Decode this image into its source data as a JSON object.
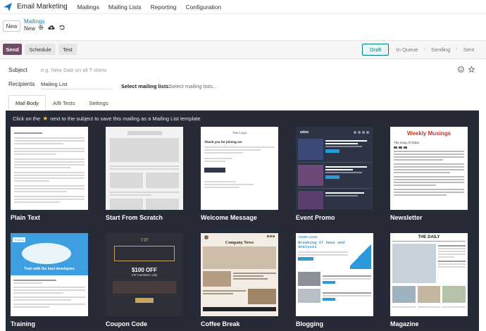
{
  "nav": {
    "app_title": "Email Marketing",
    "menu": [
      "Mailings",
      "Mailing Lists",
      "Reporting",
      "Configuration"
    ]
  },
  "control_panel": {
    "new_button": "New",
    "breadcrumb_parent": "Mailings",
    "breadcrumb_current": "New"
  },
  "actions": {
    "send": "Send",
    "schedule": "Schedule",
    "test": "Test",
    "stages": [
      "Draft",
      "In Queue",
      "Sending",
      "Sent"
    ],
    "active_stage": "Draft"
  },
  "form": {
    "subject_label": "Subject",
    "subject_placeholder": "e.g. New Sale on all T-shirts",
    "recipients_label": "Recipients",
    "recipients_value": "Mailing List",
    "mailing_lists_label": "Select mailing lists:",
    "mailing_lists_placeholder": "Select mailing lists..."
  },
  "tabs": [
    "Mail Body",
    "A/B Tests",
    "Settings"
  ],
  "active_tab": "Mail Body",
  "gallery": {
    "hint_before": "Click on the",
    "hint_after": "next to the subject to save this mailing as a Mailing List template",
    "templates": [
      "Plain Text",
      "Start From Scratch",
      "Welcome Message",
      "Event Promo",
      "Newsletter",
      "Training",
      "Coupon Code",
      "Coffee Break",
      "Blogging",
      "Magazine"
    ],
    "thumb_text": {
      "welcome_logo": "Your Logo",
      "welcome_heading": "Thank you for joining us!",
      "event_logo": "odoo",
      "newsletter_title": "Weekly Musings",
      "newsletter_sub": "The song of Odoo",
      "training_logo": "Training",
      "training_heading": "Train with the best developers",
      "coupon_vip": "VIP",
      "coupon_amount": "$100 OFF",
      "coupon_sub": "VIP members only",
      "coffee_title": "Company News",
      "blog_logo": "YOUR LOGO",
      "blog_heading": "Breaking IT news and Analysis",
      "magazine_title": "THE DAILY"
    }
  },
  "colors": {
    "brand": "#714b67",
    "accent": "#017e84",
    "link": "#1a7fa8",
    "gallery_bg": "#262a36"
  }
}
